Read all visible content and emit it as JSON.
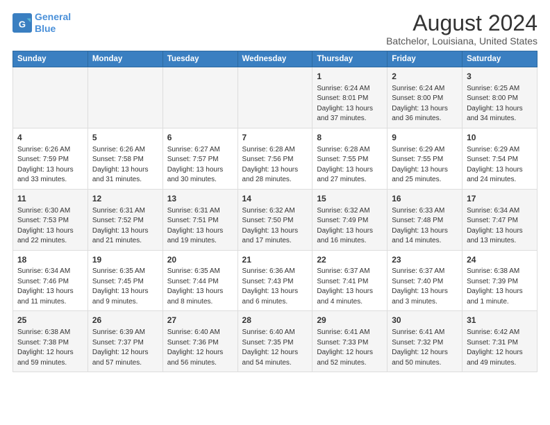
{
  "header": {
    "logo_line1": "General",
    "logo_line2": "Blue",
    "title": "August 2024",
    "subtitle": "Batchelor, Louisiana, United States"
  },
  "calendar": {
    "headers": [
      "Sunday",
      "Monday",
      "Tuesday",
      "Wednesday",
      "Thursday",
      "Friday",
      "Saturday"
    ],
    "weeks": [
      [
        {
          "day": "",
          "info": ""
        },
        {
          "day": "",
          "info": ""
        },
        {
          "day": "",
          "info": ""
        },
        {
          "day": "",
          "info": ""
        },
        {
          "day": "1",
          "info": "Sunrise: 6:24 AM\nSunset: 8:01 PM\nDaylight: 13 hours\nand 37 minutes."
        },
        {
          "day": "2",
          "info": "Sunrise: 6:24 AM\nSunset: 8:00 PM\nDaylight: 13 hours\nand 36 minutes."
        },
        {
          "day": "3",
          "info": "Sunrise: 6:25 AM\nSunset: 8:00 PM\nDaylight: 13 hours\nand 34 minutes."
        }
      ],
      [
        {
          "day": "4",
          "info": "Sunrise: 6:26 AM\nSunset: 7:59 PM\nDaylight: 13 hours\nand 33 minutes."
        },
        {
          "day": "5",
          "info": "Sunrise: 6:26 AM\nSunset: 7:58 PM\nDaylight: 13 hours\nand 31 minutes."
        },
        {
          "day": "6",
          "info": "Sunrise: 6:27 AM\nSunset: 7:57 PM\nDaylight: 13 hours\nand 30 minutes."
        },
        {
          "day": "7",
          "info": "Sunrise: 6:28 AM\nSunset: 7:56 PM\nDaylight: 13 hours\nand 28 minutes."
        },
        {
          "day": "8",
          "info": "Sunrise: 6:28 AM\nSunset: 7:55 PM\nDaylight: 13 hours\nand 27 minutes."
        },
        {
          "day": "9",
          "info": "Sunrise: 6:29 AM\nSunset: 7:55 PM\nDaylight: 13 hours\nand 25 minutes."
        },
        {
          "day": "10",
          "info": "Sunrise: 6:29 AM\nSunset: 7:54 PM\nDaylight: 13 hours\nand 24 minutes."
        }
      ],
      [
        {
          "day": "11",
          "info": "Sunrise: 6:30 AM\nSunset: 7:53 PM\nDaylight: 13 hours\nand 22 minutes."
        },
        {
          "day": "12",
          "info": "Sunrise: 6:31 AM\nSunset: 7:52 PM\nDaylight: 13 hours\nand 21 minutes."
        },
        {
          "day": "13",
          "info": "Sunrise: 6:31 AM\nSunset: 7:51 PM\nDaylight: 13 hours\nand 19 minutes."
        },
        {
          "day": "14",
          "info": "Sunrise: 6:32 AM\nSunset: 7:50 PM\nDaylight: 13 hours\nand 17 minutes."
        },
        {
          "day": "15",
          "info": "Sunrise: 6:32 AM\nSunset: 7:49 PM\nDaylight: 13 hours\nand 16 minutes."
        },
        {
          "day": "16",
          "info": "Sunrise: 6:33 AM\nSunset: 7:48 PM\nDaylight: 13 hours\nand 14 minutes."
        },
        {
          "day": "17",
          "info": "Sunrise: 6:34 AM\nSunset: 7:47 PM\nDaylight: 13 hours\nand 13 minutes."
        }
      ],
      [
        {
          "day": "18",
          "info": "Sunrise: 6:34 AM\nSunset: 7:46 PM\nDaylight: 13 hours\nand 11 minutes."
        },
        {
          "day": "19",
          "info": "Sunrise: 6:35 AM\nSunset: 7:45 PM\nDaylight: 13 hours\nand 9 minutes."
        },
        {
          "day": "20",
          "info": "Sunrise: 6:35 AM\nSunset: 7:44 PM\nDaylight: 13 hours\nand 8 minutes."
        },
        {
          "day": "21",
          "info": "Sunrise: 6:36 AM\nSunset: 7:43 PM\nDaylight: 13 hours\nand 6 minutes."
        },
        {
          "day": "22",
          "info": "Sunrise: 6:37 AM\nSunset: 7:41 PM\nDaylight: 13 hours\nand 4 minutes."
        },
        {
          "day": "23",
          "info": "Sunrise: 6:37 AM\nSunset: 7:40 PM\nDaylight: 13 hours\nand 3 minutes."
        },
        {
          "day": "24",
          "info": "Sunrise: 6:38 AM\nSunset: 7:39 PM\nDaylight: 13 hours\nand 1 minute."
        }
      ],
      [
        {
          "day": "25",
          "info": "Sunrise: 6:38 AM\nSunset: 7:38 PM\nDaylight: 12 hours\nand 59 minutes."
        },
        {
          "day": "26",
          "info": "Sunrise: 6:39 AM\nSunset: 7:37 PM\nDaylight: 12 hours\nand 57 minutes."
        },
        {
          "day": "27",
          "info": "Sunrise: 6:40 AM\nSunset: 7:36 PM\nDaylight: 12 hours\nand 56 minutes."
        },
        {
          "day": "28",
          "info": "Sunrise: 6:40 AM\nSunset: 7:35 PM\nDaylight: 12 hours\nand 54 minutes."
        },
        {
          "day": "29",
          "info": "Sunrise: 6:41 AM\nSunset: 7:33 PM\nDaylight: 12 hours\nand 52 minutes."
        },
        {
          "day": "30",
          "info": "Sunrise: 6:41 AM\nSunset: 7:32 PM\nDaylight: 12 hours\nand 50 minutes."
        },
        {
          "day": "31",
          "info": "Sunrise: 6:42 AM\nSunset: 7:31 PM\nDaylight: 12 hours\nand 49 minutes."
        }
      ]
    ]
  }
}
